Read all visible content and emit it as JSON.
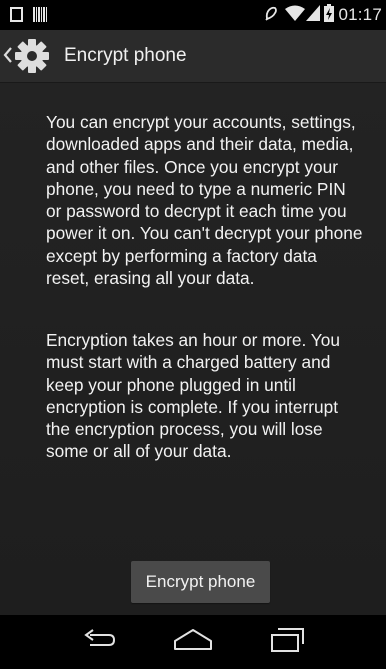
{
  "status_bar": {
    "time": "01:17",
    "icons": [
      "notification-square-icon",
      "barcode-icon",
      "alarm-icon",
      "wifi-icon",
      "signal-icon",
      "battery-charging-icon"
    ]
  },
  "action_bar": {
    "title": "Encrypt phone",
    "icons": [
      "back-chevron-icon",
      "settings-gear-icon"
    ]
  },
  "content": {
    "paragraph_1": "You can encrypt your accounts, settings, downloaded apps and their data, media, and other files. Once you encrypt your phone, you need to type a numeric PIN or password to decrypt it each time you power it on. You can't decrypt your phone except by performing a factory data reset, erasing all your data.",
    "paragraph_2": "Encryption takes an hour or more. You must start with a charged battery and keep your phone plugged in until encryption is complete. If you interrupt the encryption process, you will lose some or all of your data.",
    "button_label": "Encrypt phone"
  },
  "nav_bar": {
    "icons": [
      "back-icon",
      "home-icon",
      "recent-apps-icon"
    ]
  },
  "colors": {
    "action_bar": "#2b2b2b",
    "content_bg": "#222222",
    "button_bg": "#4a4a4a",
    "text": "#f2f2f2"
  }
}
